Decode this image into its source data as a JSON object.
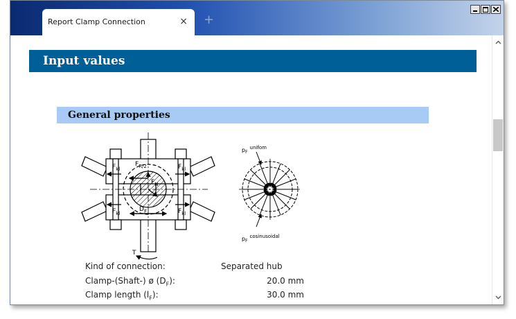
{
  "tab": {
    "title": "Report Clamp Connection",
    "close": "×"
  },
  "new_tab": "+",
  "section": {
    "title": "Input values"
  },
  "subsection": {
    "title": "General properties"
  },
  "diagram": {
    "left_labels": {
      "fkl": "F",
      "fkl_sub": "kl",
      "fr2": "F",
      "fr2_sub": "R/2",
      "fn": "F",
      "fn_sub": "N",
      "df": "D",
      "df_sub": "F",
      "torque": "T"
    },
    "right_labels": {
      "pf_uniform": "p",
      "pf_uniform_sub": "F",
      "pf_uniform_text": "unifom",
      "pf_cos": "p",
      "pf_cos_sub": "F",
      "pf_cos_text": "cosinusoidal"
    }
  },
  "properties": [
    {
      "label": "Kind of connection:",
      "value": "Separated hub"
    },
    {
      "label": "Clamp-(Shaft-) ø  (D",
      "label_sub": "F",
      "label_end": "):",
      "value": "20.0 mm"
    },
    {
      "label": "Clamp length  (l",
      "label_sub": "F",
      "label_end": "):",
      "value": "30.0 mm"
    }
  ]
}
